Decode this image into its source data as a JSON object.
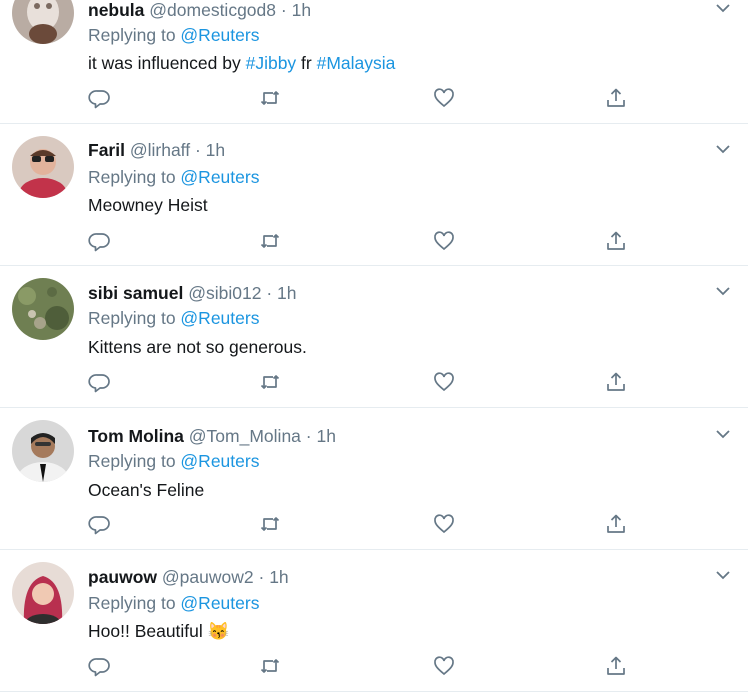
{
  "colors": {
    "link": "#1b95e0",
    "secondary": "#657786",
    "text": "#14171a",
    "divider": "#e6ecf0"
  },
  "tweets": [
    {
      "name": "nebula",
      "handle": "@domesticgod8",
      "dot": "·",
      "time": "1h",
      "replying_prefix": "Replying to ",
      "replying_to": "@Reuters",
      "text_parts": [
        "it was influenced by ",
        "#Jibby",
        " fr ",
        "#Malaysia"
      ],
      "avatar_icon": "avatar-photo"
    },
    {
      "name": "Faril",
      "handle": "@lirhaff",
      "dot": "·",
      "time": "1h",
      "replying_prefix": "Replying to ",
      "replying_to": "@Reuters",
      "text": "Meowney Heist",
      "avatar_icon": "avatar-photo"
    },
    {
      "name": "sibi samuel",
      "handle": "@sibi012",
      "dot": "·",
      "time": "1h",
      "replying_prefix": "Replying to ",
      "replying_to": "@Reuters",
      "text": "Kittens are not so generous.",
      "avatar_icon": "avatar-photo"
    },
    {
      "name": "Tom Molina",
      "handle": "@Tom_Molina",
      "dot": "·",
      "time": "1h",
      "replying_prefix": "Replying to ",
      "replying_to": "@Reuters",
      "text": "Ocean's Feline",
      "avatar_icon": "avatar-photo"
    },
    {
      "name": "pauwow",
      "handle": "@pauwow2",
      "dot": "·",
      "time": "1h",
      "replying_prefix": "Replying to ",
      "replying_to": "@Reuters",
      "text": "Hoo!! Beautiful",
      "emoji": "😽",
      "avatar_icon": "avatar-photo"
    }
  ]
}
